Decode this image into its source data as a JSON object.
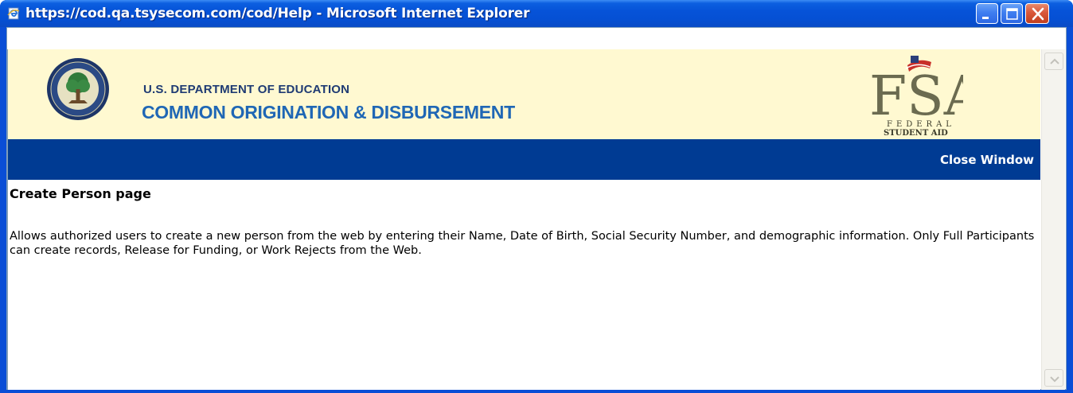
{
  "window": {
    "title": "https://cod.qa.tsysecom.com/cod/Help - Microsoft Internet Explorer",
    "icon": "ie-page-icon",
    "controls": [
      "minimize",
      "maximize",
      "close"
    ]
  },
  "banner": {
    "department": "U.S. DEPARTMENT OF EDUCATION",
    "system_name": "COMMON ORIGINATION & DISBURSEMENT",
    "seal": "department-of-education-seal",
    "logo": {
      "letters": "FSA",
      "sub1": "FEDERAL",
      "sub2": "STUDENT AID"
    }
  },
  "navbar": {
    "close_label": "Close Window"
  },
  "content": {
    "heading": "Create Person page",
    "body": "Allows authorized users to create a new person from the web by entering their Name, Date of Birth, Social Security Number, and demographic information. Only Full Participants can create records, Release for Funding, or Work Rejects from the Web."
  },
  "colors": {
    "titlebar": "#0553d4",
    "banner_bg": "#fff9d1",
    "navbar_bg": "#003b93",
    "dept_text": "#1f3b73",
    "system_text": "#1f67b5"
  }
}
